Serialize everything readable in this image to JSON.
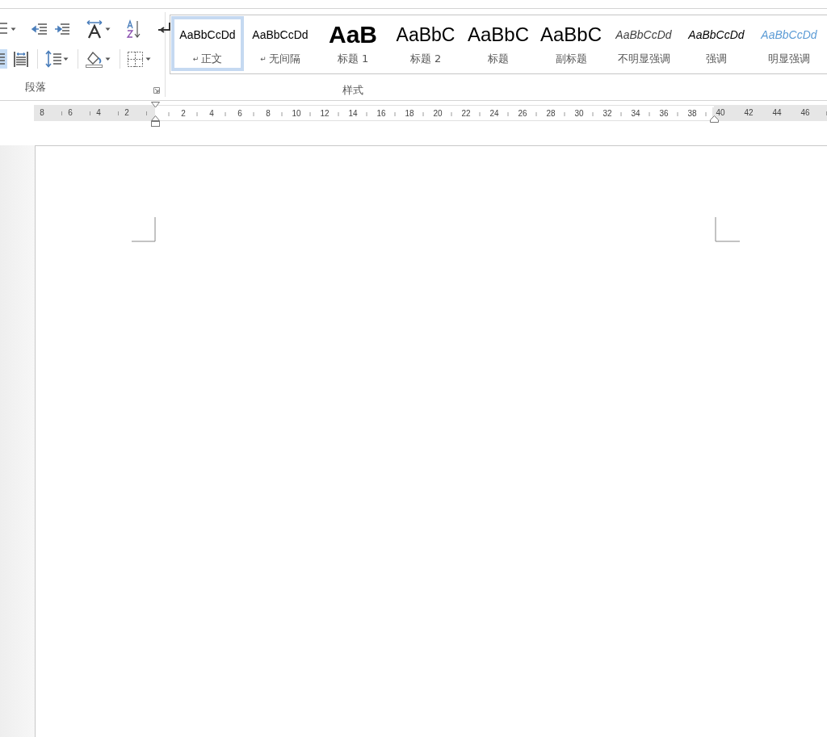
{
  "ribbon": {
    "paragraph_group": {
      "label": "段落",
      "rows": [
        [
          {
            "kind": "list",
            "selected": false,
            "has_menu": true
          },
          {
            "kind": "outdent",
            "selected": false,
            "has_menu": false
          },
          {
            "kind": "indent",
            "selected": false,
            "has_menu": false
          },
          {
            "kind": "text-direction",
            "selected": false,
            "has_menu": true
          },
          {
            "kind": "sort",
            "selected": false,
            "has_menu": false
          },
          {
            "kind": "show-marks",
            "selected": false,
            "has_menu": false
          }
        ],
        [
          {
            "kind": "justify",
            "selected": true,
            "has_menu": false
          },
          {
            "kind": "distribute",
            "selected": false,
            "has_menu": false
          },
          {
            "kind": "line-spacing",
            "selected": false,
            "has_menu": true
          },
          {
            "kind": "shading",
            "selected": false,
            "has_menu": true
          },
          {
            "kind": "borders",
            "selected": false,
            "has_menu": true
          }
        ]
      ]
    },
    "styles_group": {
      "label": "样式",
      "styles": [
        {
          "kind": "normal",
          "preview": "AaBbCcDd",
          "name": "正文",
          "mark": "↵",
          "selected": true
        },
        {
          "kind": "no-spacing",
          "preview": "AaBbCcDd",
          "name": "无间隔",
          "mark": "↵",
          "selected": false
        },
        {
          "kind": "heading1",
          "preview": "AaB",
          "name": "标题 1",
          "selected": false
        },
        {
          "kind": "heading2",
          "preview": "AaBbC",
          "name": "标题 2",
          "selected": false
        },
        {
          "kind": "title",
          "preview": "AaBbC",
          "name": "标题",
          "selected": false
        },
        {
          "kind": "subtitle",
          "preview": "AaBbC",
          "name": "副标题",
          "selected": false
        },
        {
          "kind": "subtle-emphasis",
          "preview": "AaBbCcDd",
          "name": "不明显强调",
          "selected": false
        },
        {
          "kind": "emphasis",
          "preview": "AaBbCcDd",
          "name": "强调",
          "selected": false
        },
        {
          "kind": "intense-emphasis",
          "preview": "AaBbCcDd",
          "name": "明显强调",
          "selected": false
        }
      ]
    }
  },
  "ruler": {
    "sections": [
      {
        "kind": "margin",
        "labels": [
          "8",
          "6",
          "4",
          "2"
        ]
      },
      {
        "kind": "text",
        "labels": [
          "2",
          "4",
          "6",
          "8",
          "10",
          "12",
          "14",
          "16",
          "18",
          "20",
          "22",
          "24",
          "26",
          "28",
          "30",
          "32",
          "34",
          "36",
          "38"
        ]
      },
      {
        "kind": "margin",
        "labels": [
          "40",
          "42",
          "44",
          "46"
        ]
      }
    ]
  }
}
